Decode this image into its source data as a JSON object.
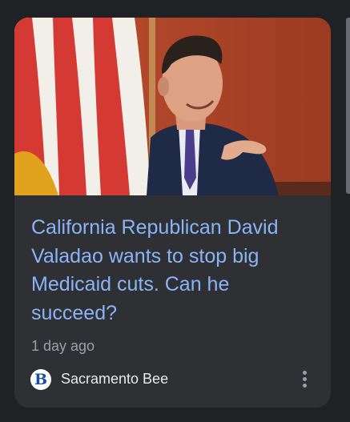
{
  "card": {
    "headline": "California Republican David Valadao wants to stop big Medicaid cuts. Can he succeed?",
    "timestamp": "1 day ago",
    "source": {
      "name": "Sacramento Bee",
      "logo_letter": "B"
    },
    "menu_icon": "more-vert-icon",
    "image_alt": "David Valadao smiling and gesturing in front of an American flag"
  },
  "colors": {
    "background": "#202124",
    "card": "#2f3034",
    "headline": "#8ab4f8",
    "timestamp": "#9aa0a6",
    "source_name": "#e8eaed",
    "logo": "#1c4f9c"
  }
}
